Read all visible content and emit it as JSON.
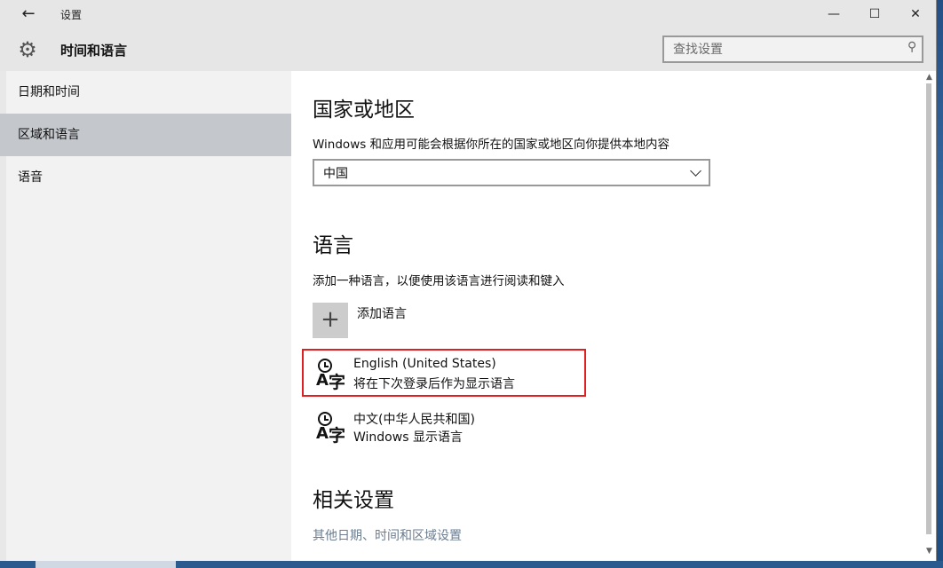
{
  "window": {
    "title": "设置",
    "back_icon": "←",
    "minimize_icon": "—",
    "maximize_icon": "☐",
    "close_icon": "✕"
  },
  "header": {
    "title": "时间和语言",
    "gear_icon": "⚙"
  },
  "search": {
    "placeholder": "查找设置",
    "icon": "⚲"
  },
  "sidebar": {
    "items": [
      {
        "label": "日期和时间",
        "active": false
      },
      {
        "label": "区域和语言",
        "active": true
      },
      {
        "label": "语音",
        "active": false
      }
    ]
  },
  "region": {
    "heading": "国家或地区",
    "description": "Windows 和应用可能会根据你所在的国家或地区向你提供本地内容",
    "selected_country": "中国"
  },
  "language": {
    "heading": "语言",
    "description": "添加一种语言，以便使用该语言进行阅读和键入",
    "add_label": "添加语言",
    "add_icon": "+",
    "items": [
      {
        "name": "English (United States)",
        "status": "将在下次登录后作为显示语言",
        "highlighted": true
      },
      {
        "name": "中文(中华人民共和国)",
        "status": "Windows 显示语言",
        "highlighted": false
      }
    ],
    "icon_letter": "A",
    "icon_char": "字"
  },
  "related": {
    "heading": "相关设置",
    "link": "其他日期、时间和区域设置"
  },
  "colors": {
    "highlight_border": "#e02020",
    "active_sidebar": "#c4c8cd",
    "link": "#6b7d8f"
  }
}
